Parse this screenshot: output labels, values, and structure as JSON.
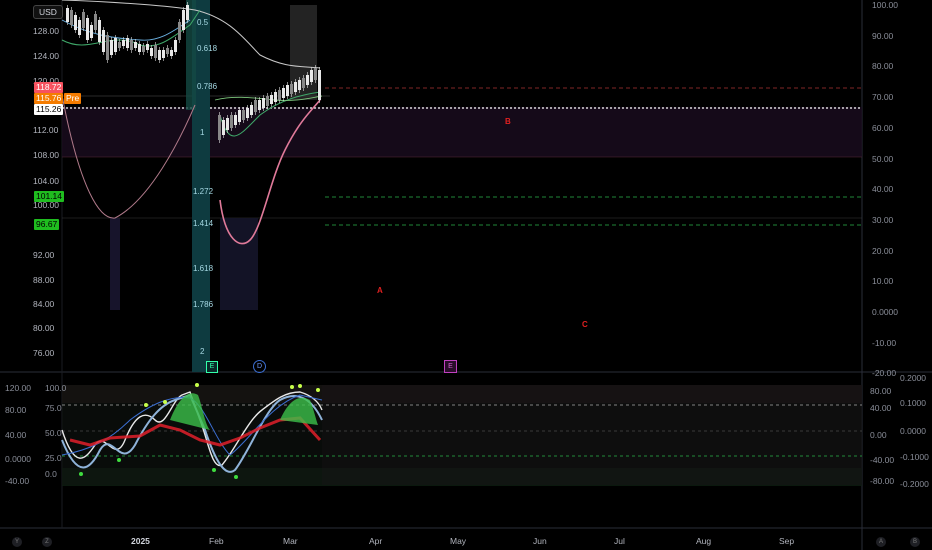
{
  "currency_label": "USD",
  "price_badges": {
    "p1": {
      "text": "118.72",
      "color": "#f7525f"
    },
    "p2": {
      "text": "115.76",
      "color": "#f57c00"
    },
    "pre": {
      "text": "Pre",
      "color": "#f57c00"
    },
    "p3": {
      "text": "115.26",
      "color": "#ffffff"
    },
    "p4": {
      "text": "101.14",
      "color": "#22ab22"
    },
    "p5": {
      "text": "96.67",
      "color": "#22ab22"
    }
  },
  "left_price_axis": [
    "128.00",
    "124.00",
    "120.00",
    "112.00",
    "108.00",
    "104.00",
    "100.00",
    "92.00",
    "88.00",
    "84.00",
    "80.00",
    "76.00"
  ],
  "right_axis_main": [
    "100.00",
    "90.00",
    "80.00",
    "70.00",
    "60.00",
    "50.00",
    "40.00",
    "30.00",
    "20.00",
    "10.00",
    "0.0000",
    "-10.00",
    "-20.00"
  ],
  "fib_levels": [
    "0.5",
    "0.618",
    "0.786",
    "1",
    "1.272",
    "1.414",
    "1.618",
    "1.786",
    "2"
  ],
  "event_markers": {
    "earnings": "E",
    "dividend": "D",
    "future": "E"
  },
  "annotations": {
    "a": "A",
    "b": "B",
    "c": "C"
  },
  "osc_left_axis": [
    "100.0",
    "75.0",
    "50.0",
    "25.0",
    "0.0"
  ],
  "osc_far_left_axis": [
    "120.00",
    "80.00",
    "40.00",
    "0.0000",
    "-40.00"
  ],
  "osc_right_axis_1": [
    "80.00",
    "40.00",
    "0.00",
    "-40.00",
    "-80.00"
  ],
  "osc_right_axis_2": [
    "0.2000",
    "0.1000",
    "0.0000",
    "-0.1000",
    "-0.2000"
  ],
  "time_axis": [
    "2025",
    "Feb",
    "Mar",
    "Apr",
    "May",
    "Jun",
    "Jul",
    "Aug",
    "Sep"
  ],
  "corner_buttons": {
    "left": [
      "Y",
      "Z"
    ],
    "right": [
      "A",
      "B"
    ]
  },
  "colors": {
    "up": "#26a69a",
    "down": "#ef5350",
    "accent_purple": "#9c27b0",
    "fib_band": "#0e3b40"
  }
}
